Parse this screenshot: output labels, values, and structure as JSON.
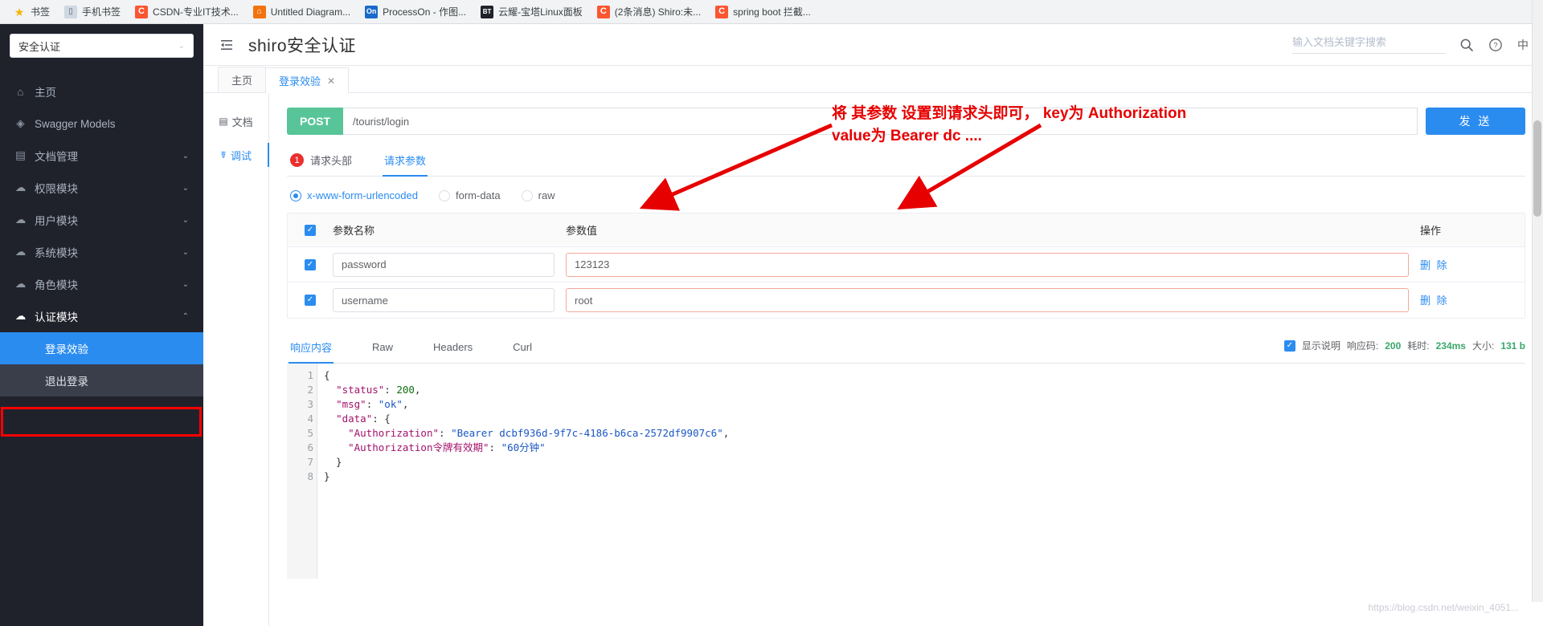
{
  "browser": {
    "bookmarks": [
      {
        "label": "书签",
        "icon": "star-icon",
        "icon_class": "ico-star",
        "icon_text": "★"
      },
      {
        "label": "手机书签",
        "icon": "phone-icon",
        "icon_class": "ico-phone",
        "icon_text": "▯"
      },
      {
        "label": "CSDN-专业IT技术...",
        "icon": "csdn-icon",
        "icon_class": "ico-c",
        "icon_text": "C"
      },
      {
        "label": "Untitled Diagram...",
        "icon": "drawio-icon",
        "icon_class": "ico-diagram",
        "icon_text": "⌂"
      },
      {
        "label": "ProcessOn - 作图...",
        "icon": "processon-icon",
        "icon_class": "ico-on",
        "icon_text": "On"
      },
      {
        "label": "云耀-宝塔Linux面板",
        "icon": "baota-icon",
        "icon_class": "ico-bt",
        "icon_text": "BT"
      },
      {
        "label": "(2条消息) Shiro:未...",
        "icon": "csdn-icon",
        "icon_class": "ico-c",
        "icon_text": "C"
      },
      {
        "label": "spring boot 拦截...",
        "icon": "csdn-icon",
        "icon_class": "ico-c",
        "icon_text": "C"
      }
    ]
  },
  "sidebar": {
    "project_value": "安全认证",
    "caret": "⌄",
    "items": [
      {
        "label": "主页",
        "icon": "home-icon",
        "glyph": "⌂",
        "arrow": ""
      },
      {
        "label": "Swagger Models",
        "icon": "cube-icon",
        "glyph": "◈",
        "arrow": ""
      },
      {
        "label": "文档管理",
        "icon": "doc-gear-icon",
        "glyph": "▤",
        "arrow": "⌄"
      },
      {
        "label": "权限模块",
        "icon": "cloud-icon",
        "glyph": "☁",
        "arrow": "⌄"
      },
      {
        "label": "用户模块",
        "icon": "cloud-icon",
        "glyph": "☁",
        "arrow": "⌄"
      },
      {
        "label": "系统模块",
        "icon": "cloud-icon",
        "glyph": "☁",
        "arrow": "⌄"
      },
      {
        "label": "角色模块",
        "icon": "cloud-icon",
        "glyph": "☁",
        "arrow": "⌄"
      },
      {
        "label": "认证模块",
        "icon": "cloud-icon",
        "glyph": "☁",
        "arrow": "⌃"
      }
    ],
    "submenu": [
      {
        "label": "登录效验",
        "selected": true
      },
      {
        "label": "退出登录",
        "selected": false
      }
    ]
  },
  "header": {
    "title": "shiro安全认证",
    "collapse_icon": "collapse-menu-icon",
    "search_placeholder": "输入文档关键字搜索",
    "search_value": "",
    "lang_label": "中"
  },
  "page_tabs": [
    {
      "label": "主页",
      "active": false,
      "closable": false
    },
    {
      "label": "登录效验",
      "active": true,
      "closable": true,
      "close": "✕"
    }
  ],
  "vtabs": [
    {
      "label": "文档",
      "icon": "document-icon",
      "glyph": "▤",
      "active": false
    },
    {
      "label": "调试",
      "icon": "bug-icon",
      "glyph": "☤",
      "active": true
    }
  ],
  "request": {
    "method": "POST",
    "url": "/tourist/login",
    "url_placeholder": "",
    "send_label": "发 送",
    "tabs": [
      {
        "label": "请求头部",
        "badge": "1",
        "active": false
      },
      {
        "label": "请求参数",
        "badge": "",
        "active": true
      }
    ],
    "body_types": [
      {
        "label": "x-www-form-urlencoded",
        "checked": true
      },
      {
        "label": "form-data",
        "checked": false
      },
      {
        "label": "raw",
        "checked": false
      }
    ],
    "table": {
      "headers": [
        "参数名称",
        "参数值",
        "操作"
      ],
      "rows": [
        {
          "checked": true,
          "name": "password",
          "value": "123123",
          "op": "删 除"
        },
        {
          "checked": true,
          "name": "username",
          "value": "root",
          "op": "删 除"
        }
      ]
    }
  },
  "response": {
    "tabs": [
      {
        "label": "响应内容",
        "active": true
      },
      {
        "label": "Raw",
        "active": false
      },
      {
        "label": "Headers",
        "active": false
      },
      {
        "label": "Curl",
        "active": false
      }
    ],
    "meta": {
      "show_desc_label": "显示说明",
      "show_desc_checked": true,
      "status_label": "响应码:",
      "status_value": "200",
      "time_label": "耗时:",
      "time_value": "234ms",
      "size_label": "大小:",
      "size_value": "131 b"
    },
    "line_numbers": [
      "1",
      "2",
      "3",
      "4",
      "5",
      "6",
      "7",
      "8"
    ],
    "fold_markers": {
      "1": "▾",
      "4": "▾"
    },
    "code_lines": [
      [
        {
          "t": "{",
          "c": "p"
        }
      ],
      [
        {
          "t": "  ",
          "c": "p"
        },
        {
          "t": "\"status\"",
          "c": "k"
        },
        {
          "t": ": ",
          "c": "p"
        },
        {
          "t": "200",
          "c": "n"
        },
        {
          "t": ",",
          "c": "p"
        }
      ],
      [
        {
          "t": "  ",
          "c": "p"
        },
        {
          "t": "\"msg\"",
          "c": "k"
        },
        {
          "t": ": ",
          "c": "p"
        },
        {
          "t": "\"ok\"",
          "c": "s"
        },
        {
          "t": ",",
          "c": "p"
        }
      ],
      [
        {
          "t": "  ",
          "c": "p"
        },
        {
          "t": "\"data\"",
          "c": "k"
        },
        {
          "t": ": {",
          "c": "p"
        }
      ],
      [
        {
          "t": "    ",
          "c": "p"
        },
        {
          "t": "\"Authorization\"",
          "c": "k"
        },
        {
          "t": ": ",
          "c": "p"
        },
        {
          "t": "\"Bearer dcbf936d-9f7c-4186-b6ca-2572df9907c6\"",
          "c": "s"
        },
        {
          "t": ",",
          "c": "p"
        }
      ],
      [
        {
          "t": "    ",
          "c": "p"
        },
        {
          "t": "\"Authorization令牌有效期\"",
          "c": "k"
        },
        {
          "t": ": ",
          "c": "p"
        },
        {
          "t": "\"60分钟\"",
          "c": "s"
        }
      ],
      [
        {
          "t": "  }",
          "c": "p"
        }
      ],
      [
        {
          "t": "}",
          "c": "p"
        }
      ]
    ]
  },
  "annotation": {
    "text": "将 其参数 设置到请求头即可， key为 Authorization\nvalue为 Bearer dc ....",
    "color": "#e60000"
  },
  "watermark": "https://blog.csdn.net/weixin_4051...",
  "colors": {
    "accent": "#2b8cf0",
    "method_post": "#58c598",
    "sidebar_bg": "#20222b",
    "danger": "#e8312f",
    "annotation": "#e60000",
    "success": "#3aa76d"
  }
}
